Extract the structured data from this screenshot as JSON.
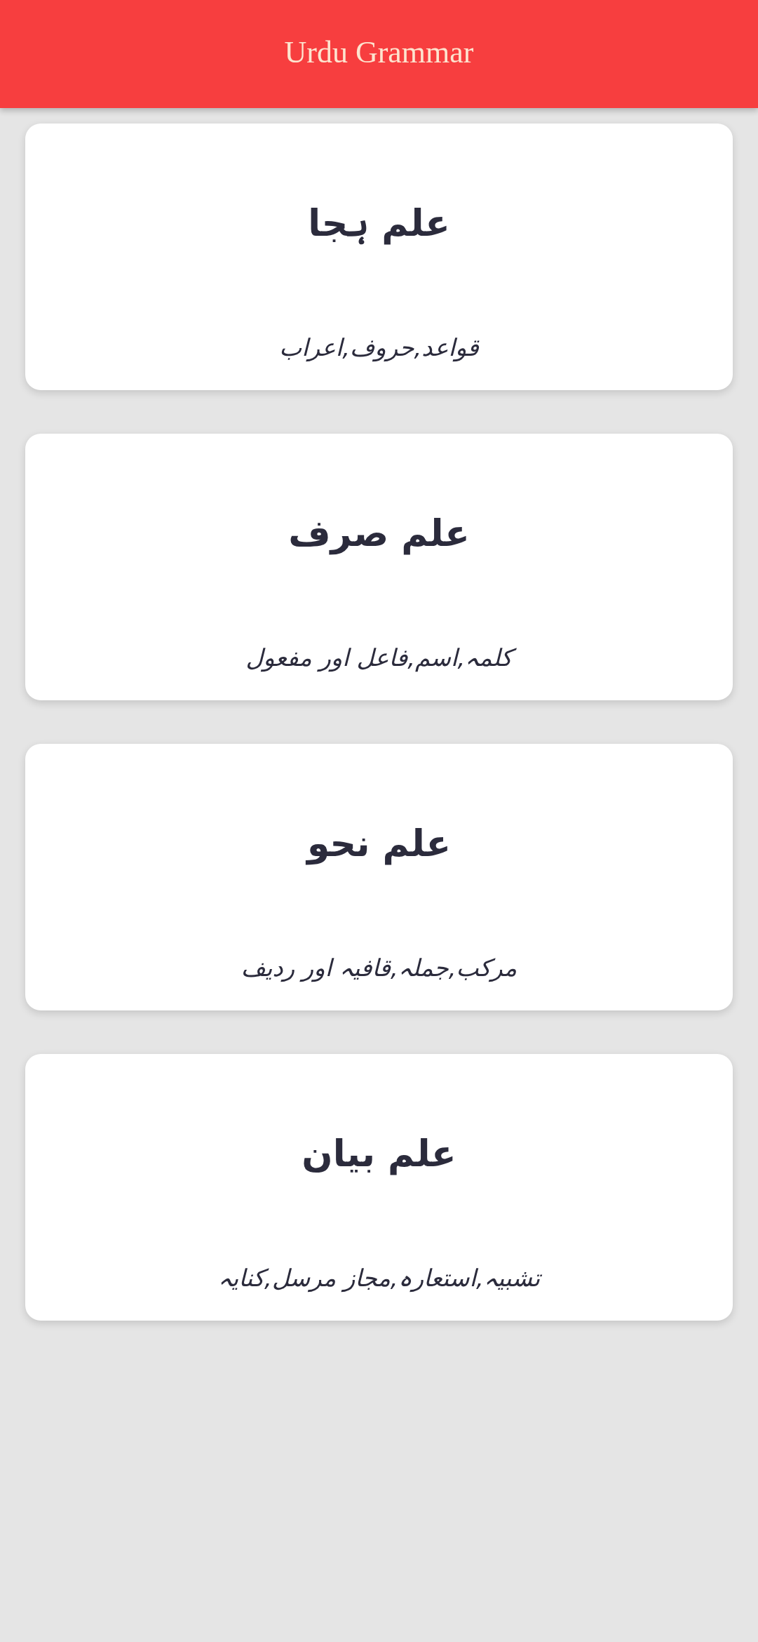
{
  "app_bar": {
    "title": "Urdu Grammar"
  },
  "cards": [
    {
      "title": "علم ہجا",
      "subtitle": "قواعد,حروف,اعراب"
    },
    {
      "title": "علم صرف",
      "subtitle": "کلمہ,اسم,فاعل اور مفعول"
    },
    {
      "title": "علم نحو",
      "subtitle": "مرکب,جملہ,قافیہ اور ردیف"
    },
    {
      "title": "علم بیان",
      "subtitle": "تشبیہ,استعارہ,مجاز مرسل,کنایہ"
    }
  ]
}
